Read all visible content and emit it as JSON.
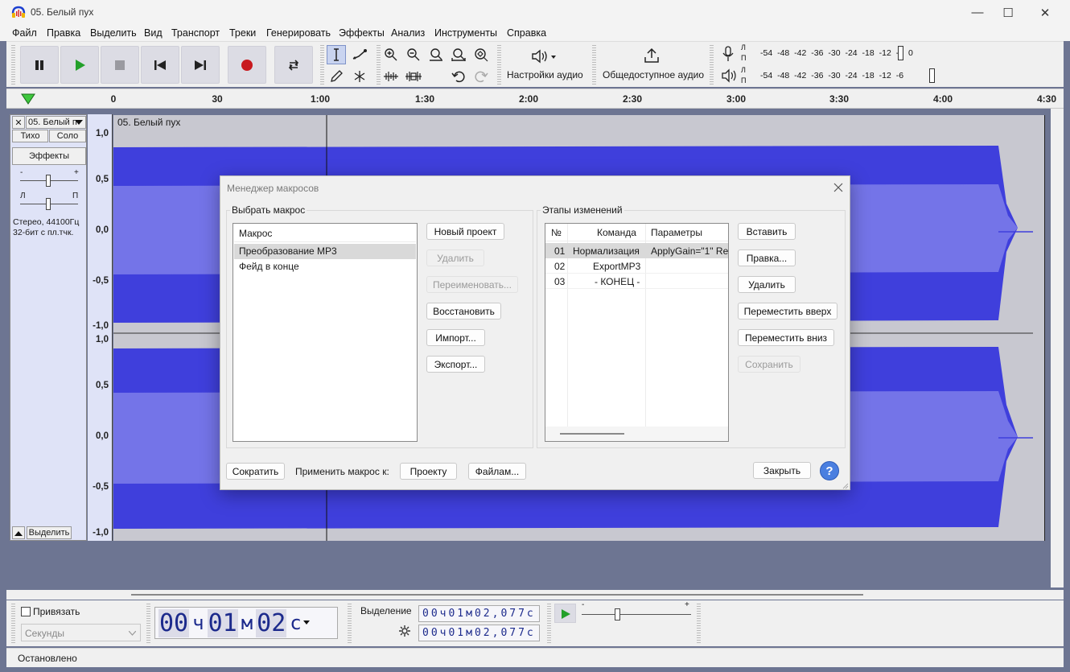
{
  "window": {
    "title": "05. Белый пух",
    "controls": {
      "minimize": "—",
      "maximize": "☐",
      "close": "✕"
    }
  },
  "menu": [
    "Файл",
    "Правка",
    "Выделить",
    "Вид",
    "Транспорт",
    "Треки",
    "Генерировать",
    "Эффекты",
    "Анализ",
    "Инструменты",
    "Справка"
  ],
  "toolbar": {
    "audio_setup": "Настройки аудио",
    "share_audio": "Общедоступное аудио",
    "meter_scale": "-54 -48 -42 -36 -30 -24 -18 -12 -6 0",
    "meter_scale_play": "-54 -48 -42 -36 -30 -24 -18 -12 -6",
    "lr_top": "Л",
    "lr_bottom": "П"
  },
  "ruler": {
    "ticks": [
      "0",
      "30",
      "1:00",
      "1:30",
      "2:00",
      "2:30",
      "3:00",
      "3:30",
      "4:00",
      "4:30"
    ]
  },
  "track": {
    "name": "05. Белый п",
    "clip_name": "05. Белый пух",
    "mute": "Тихо",
    "solo": "Соло",
    "effects": "Эффекты",
    "gain_min": "-",
    "gain_max": "+",
    "pan_left": "Л",
    "pan_right": "П",
    "info_line1": "Стерео, 44100Гц",
    "info_line2": "32-бит с пл.тчк.",
    "select": "Выделить",
    "vruler_top": [
      "1,0",
      "0,5",
      "0,0",
      "-0,5",
      "-1,0"
    ],
    "vruler_bottom": [
      "1,0",
      "0,5",
      "0,0",
      "-0,5",
      "-1,0"
    ]
  },
  "bottom": {
    "snap_label": "Привязать",
    "snap_unit": "Секунды",
    "time_big": [
      "00",
      "ч",
      "01",
      "м",
      "02",
      "с"
    ],
    "selection_label": "Выделение",
    "sel_start": "00ч01м02,077с",
    "sel_end": "00ч01м02,077с",
    "speed_min": "-",
    "speed_max": "+"
  },
  "status": {
    "text": "Остановлено"
  },
  "dialog": {
    "title": "Менеджер макросов",
    "left_group": "Выбрать макрос",
    "macro_header": "Макрос",
    "macros": [
      "Преобразование MP3",
      "Фейд в конце"
    ],
    "selected_macro": 0,
    "buttons_left": {
      "new": "Новый проект",
      "delete": "Удалить",
      "rename": "Переименовать...",
      "restore": "Восстановить",
      "import": "Импорт...",
      "export": "Экспорт..."
    },
    "right_group": "Этапы изменений",
    "steps_headers": [
      "№",
      "Команда",
      "Параметры"
    ],
    "steps": [
      {
        "n": "01",
        "cmd": "Нормализация",
        "params": "ApplyGain=\"1\" Re"
      },
      {
        "n": "02",
        "cmd": "ExportMP3",
        "params": ""
      },
      {
        "n": "03",
        "cmd": "- КОНЕЦ -",
        "params": ""
      }
    ],
    "buttons_right": {
      "insert": "Вставить",
      "edit": "Правка...",
      "delete": "Удалить",
      "up": "Переместить вверх",
      "down": "Переместить вниз",
      "save": "Сохранить"
    },
    "footer": {
      "shrink": "Сократить",
      "apply_label": "Применить макрос к:",
      "project": "Проекту",
      "files": "Файлам...",
      "close": "Закрыть",
      "help": "?"
    }
  }
}
